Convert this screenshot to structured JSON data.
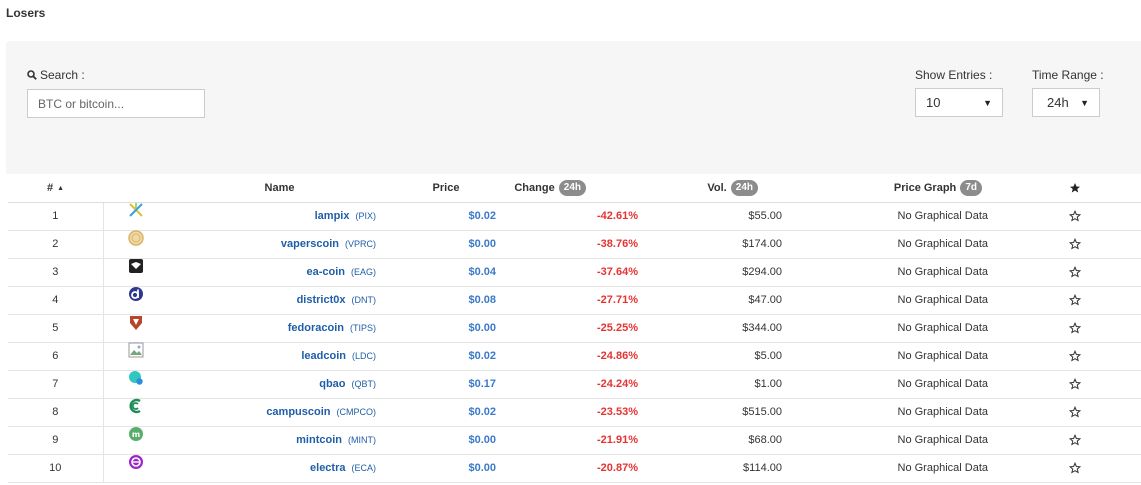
{
  "page": {
    "title": "Losers"
  },
  "filters": {
    "search_label": "Search :",
    "search_placeholder": "BTC or bitcoin...",
    "entries_label": "Show Entries :",
    "entries_value": "10",
    "range_label": "Time Range :",
    "range_value": "24h"
  },
  "table": {
    "headers": {
      "rank": "#",
      "name": "Name",
      "price": "Price",
      "change": "Change",
      "change_badge": "24h",
      "vol": "Vol.",
      "vol_badge": "24h",
      "graph": "Price Graph",
      "graph_badge": "7d"
    },
    "rows": [
      {
        "rank": "1",
        "name": "lampix",
        "symbol": "(PIX)",
        "price": "$0.02",
        "change": "-42.61%",
        "vol": "$55.00",
        "graph": "No Graphical Data",
        "icon": "lampix-icon",
        "color": "#c9c93a"
      },
      {
        "rank": "2",
        "name": "vaperscoin",
        "symbol": "(VPRC)",
        "price": "$0.00",
        "change": "-38.76%",
        "vol": "$174.00",
        "graph": "No Graphical Data",
        "icon": "vaperscoin-icon",
        "color": "#d8b46a"
      },
      {
        "rank": "3",
        "name": "ea-coin",
        "symbol": "(EAG)",
        "price": "$0.04",
        "change": "-37.64%",
        "vol": "$294.00",
        "graph": "No Graphical Data",
        "icon": "ea-coin-icon",
        "color": "#222222"
      },
      {
        "rank": "4",
        "name": "district0x",
        "symbol": "(DNT)",
        "price": "$0.08",
        "change": "-27.71%",
        "vol": "$47.00",
        "graph": "No Graphical Data",
        "icon": "district0x-icon",
        "color": "#2c398f"
      },
      {
        "rank": "5",
        "name": "fedoracoin",
        "symbol": "(TIPS)",
        "price": "$0.00",
        "change": "-25.25%",
        "vol": "$344.00",
        "graph": "No Graphical Data",
        "icon": "fedoracoin-icon",
        "color": "#b5452b"
      },
      {
        "rank": "6",
        "name": "leadcoin",
        "symbol": "(LDC)",
        "price": "$0.02",
        "change": "-24.86%",
        "vol": "$5.00",
        "graph": "No Graphical Data",
        "icon": "broken-image-icon",
        "color": "#7aa57a"
      },
      {
        "rank": "7",
        "name": "qbao",
        "symbol": "(QBT)",
        "price": "$0.17",
        "change": "-24.24%",
        "vol": "$1.00",
        "graph": "No Graphical Data",
        "icon": "qbao-icon",
        "color": "#2fc7c0"
      },
      {
        "rank": "8",
        "name": "campuscoin",
        "symbol": "(CMPCO)",
        "price": "$0.02",
        "change": "-23.53%",
        "vol": "$515.00",
        "graph": "No Graphical Data",
        "icon": "campuscoin-icon",
        "color": "#1f8f5a"
      },
      {
        "rank": "9",
        "name": "mintcoin",
        "symbol": "(MINT)",
        "price": "$0.00",
        "change": "-21.91%",
        "vol": "$68.00",
        "graph": "No Graphical Data",
        "icon": "mintcoin-icon",
        "color": "#5aae6b"
      },
      {
        "rank": "10",
        "name": "electra",
        "symbol": "(ECA)",
        "price": "$0.00",
        "change": "-20.87%",
        "vol": "$114.00",
        "graph": "No Graphical Data",
        "icon": "electra-icon",
        "color": "#9b27c9"
      }
    ]
  }
}
